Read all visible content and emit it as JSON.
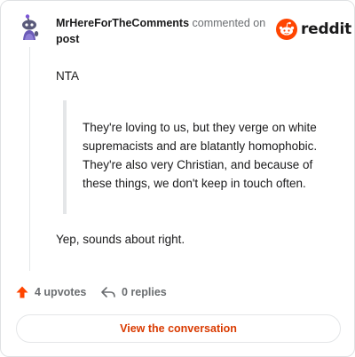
{
  "comment": {
    "author": "MrHereForTheComments",
    "action_text": "commented on",
    "target": "post",
    "paragraphs": {
      "intro": "NTA",
      "quote": "They're loving to us, but they verge on white supremacists and are blatantly homophobic. They're also very Christian, and because of these things, we don't keep in touch often.",
      "reply": "Yep, sounds about right."
    }
  },
  "brand": {
    "wordmark": "reddit",
    "color": "#ff4500"
  },
  "actions": {
    "upvotes": "4 upvotes",
    "replies": "0 replies"
  },
  "cta": {
    "label": "View the conversation",
    "color": "#d93a00"
  },
  "icons": {
    "avatar": "snoo-avatar-icon",
    "logo": "reddit-snoo-icon",
    "upvote": "upvote-arrow-icon",
    "reply": "reply-arrow-icon"
  }
}
